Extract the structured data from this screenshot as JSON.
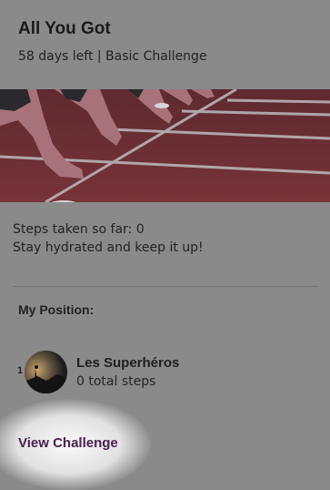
{
  "challenge": {
    "title": "All You Got",
    "meta": "58 days left | Basic Challenge",
    "steps_text": "Steps taken so far: 0",
    "encouragement": "Stay hydrated and keep it up!"
  },
  "position": {
    "label": "My Position:",
    "rank": "1",
    "team_name": "Les Superhéros",
    "team_steps": "0 total steps"
  },
  "actions": {
    "view_challenge": "View Challenge"
  },
  "colors": {
    "overlay_gray": "#8a8a8a",
    "track_red": "#6e2f33",
    "link_purple": "#4a2152"
  }
}
